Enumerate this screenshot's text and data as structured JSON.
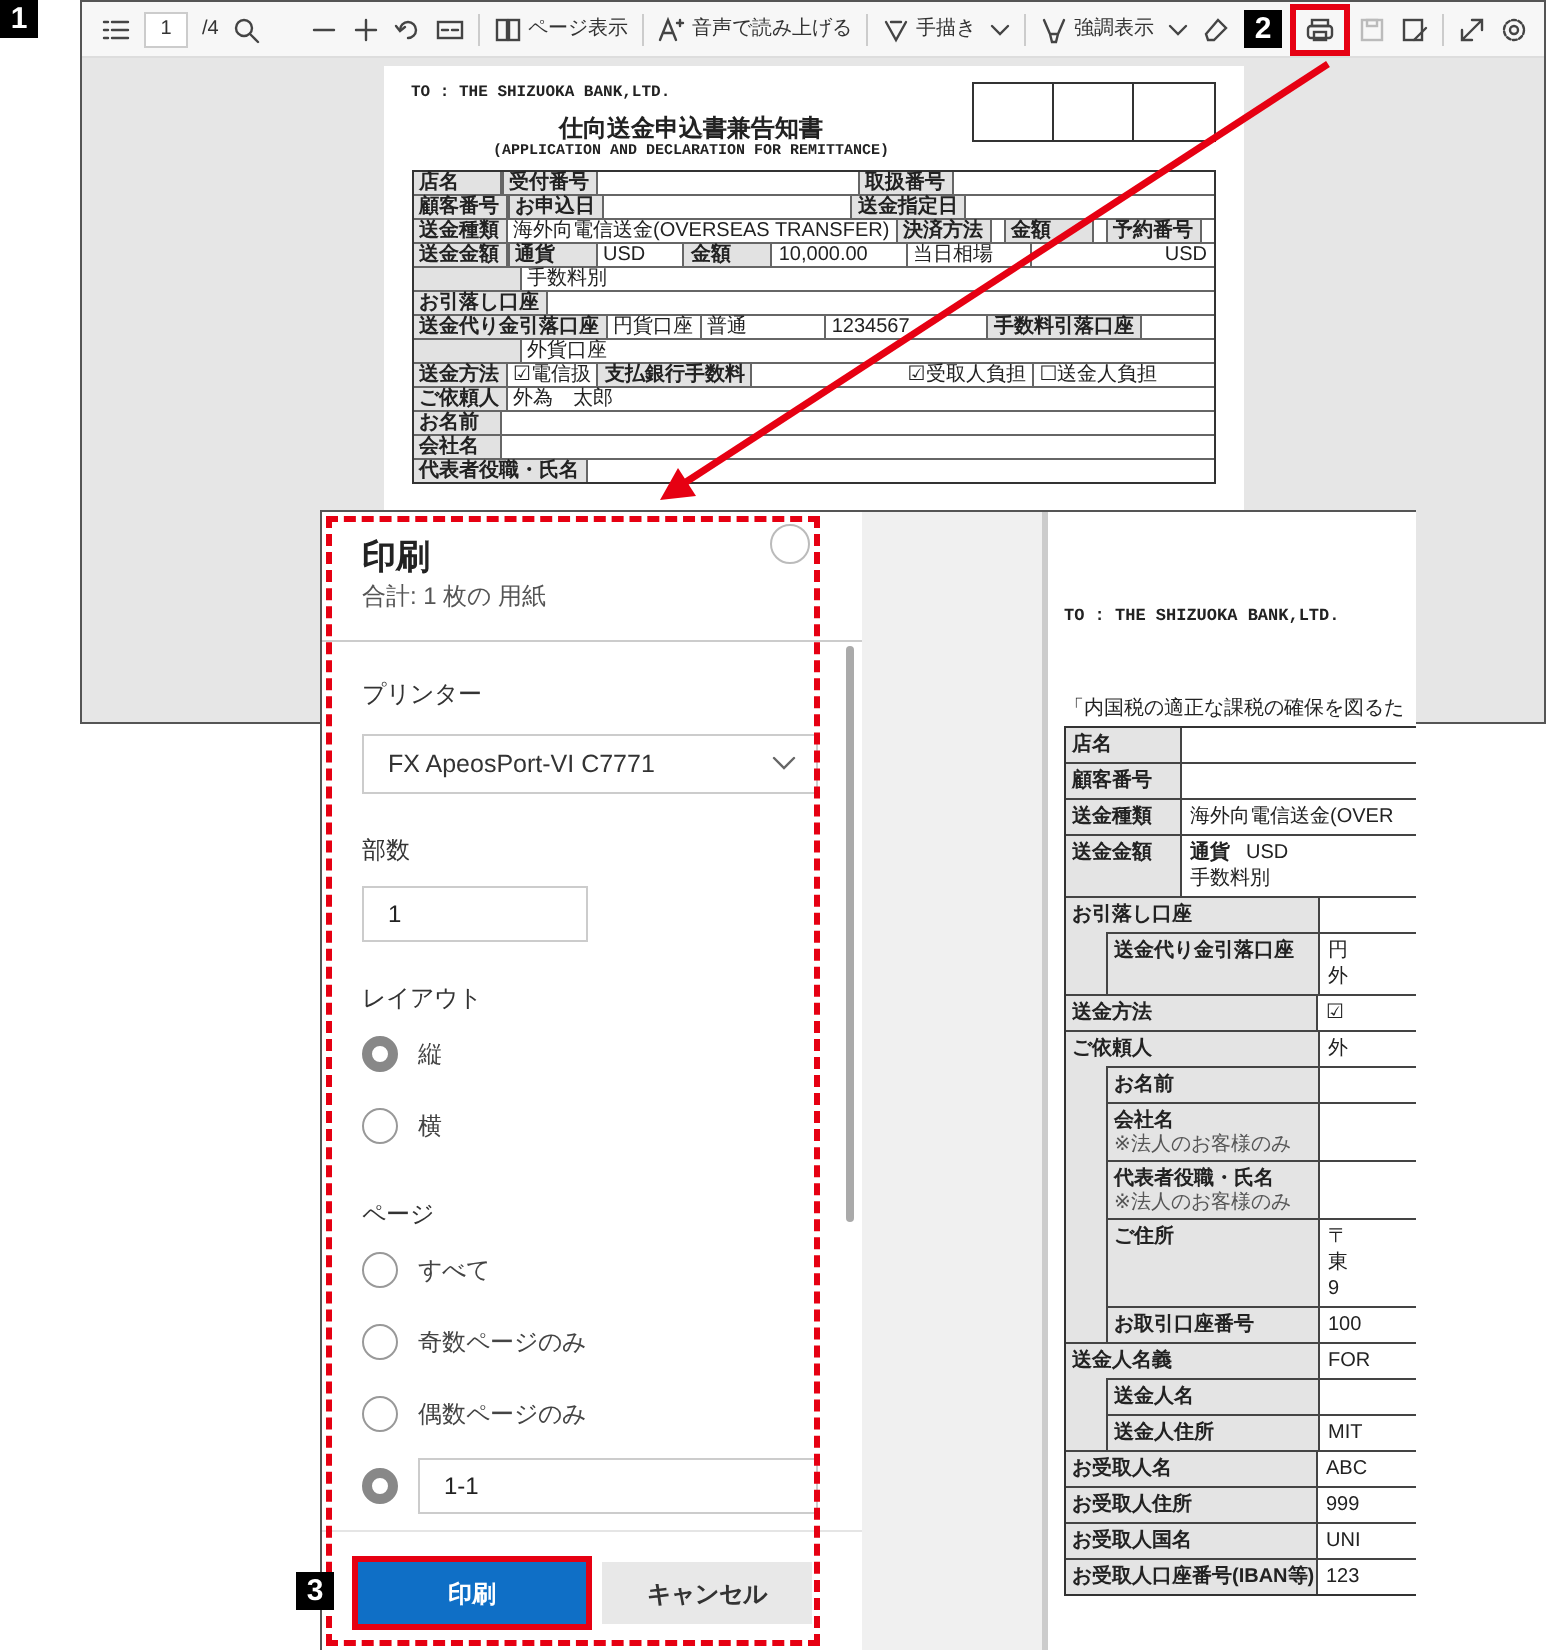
{
  "callouts": [
    "1",
    "2",
    "3"
  ],
  "viewer": {
    "toolbar": {
      "page_number": "1",
      "page_total": "/4",
      "actions": [
        {
          "kind": "page-view",
          "label": "ページ表示",
          "dropdown": false
        },
        {
          "kind": "read-aloud",
          "label": "音声で読み上げる",
          "dropdown": false
        },
        {
          "kind": "draw",
          "label": "手描き",
          "dropdown": true
        },
        {
          "kind": "highlight",
          "label": "強調表示",
          "dropdown": true
        }
      ]
    },
    "document": {
      "addressee": "TO : THE SHIZUOKA BANK,LTD.",
      "title": "仕向送金申込書兼告知書",
      "subtitle": "(APPLICATION AND DECLARATION FOR REMITTANCE)",
      "lines": [
        {
          "fields": [
            {
              "label": "店名"
            },
            {
              "label": "受付番号"
            },
            {
              "label": "取扱番号"
            }
          ]
        },
        {
          "fields": [
            {
              "label": "顧客番号"
            },
            {
              "label": "お申込日"
            },
            {
              "label": "送金指定日"
            }
          ]
        },
        {
          "fields": [
            {
              "label": "送金種類",
              "value": "海外向電信送金(OVERSEAS TRANSFER)"
            },
            {
              "label": "決済方法"
            },
            {
              "label": "金額"
            },
            {
              "label": "予約番号"
            }
          ]
        },
        {
          "fields": [
            {
              "label": "送金金額"
            },
            {
              "label": "通貨",
              "value": "USD"
            },
            {
              "label": "金額",
              "value": "10,000.00"
            },
            {
              "value": "当日相場"
            },
            {
              "value": "USD"
            }
          ]
        },
        {
          "fields": [
            {
              "value": "手数料別"
            }
          ]
        },
        {
          "fields": [
            {
              "label": "お引落し口座"
            }
          ]
        },
        {
          "fields": [
            {
              "label": "送金代り金引落口座",
              "value": "円貨口座"
            },
            {
              "value": "普通"
            },
            {
              "value": "1234567"
            },
            {
              "label": "手数料引落口座"
            }
          ]
        },
        {
          "fields": [
            {
              "value": "外貨口座"
            }
          ]
        },
        {
          "fields": [
            {
              "label": "送金方法",
              "value": "☑電信扱"
            },
            {
              "label": "支払銀行手数料",
              "value": "☑受取人負担"
            },
            {
              "value": "☐送金人負担"
            }
          ]
        },
        {
          "fields": [
            {
              "label": "ご依頼人",
              "value": "外為　太郎"
            }
          ]
        },
        {
          "fields": [
            {
              "label": "お名前"
            }
          ]
        },
        {
          "fields": [
            {
              "label": "会社名"
            }
          ]
        },
        {
          "fields": [
            {
              "label": "代表者役職・氏名"
            }
          ]
        }
      ]
    }
  },
  "print_dialog": {
    "title": "印刷",
    "summary": "合計: 1 枚の 用紙",
    "printer": {
      "label": "プリンター",
      "value": "FX ApeosPort-VI C7771"
    },
    "copies": {
      "label": "部数",
      "value": "1"
    },
    "layout": {
      "label": "レイアウト",
      "options": [
        {
          "label": "縦",
          "selected": true
        },
        {
          "label": "横",
          "selected": false
        }
      ]
    },
    "pages": {
      "label": "ページ",
      "options": [
        {
          "kind": "radio",
          "label": "すべて",
          "selected": false
        },
        {
          "kind": "radio",
          "label": "奇数ページのみ",
          "selected": false
        },
        {
          "kind": "radio",
          "label": "偶数ページのみ",
          "selected": false
        },
        {
          "kind": "range",
          "value": "1-1",
          "selected": true
        }
      ]
    },
    "buttons": [
      {
        "kind": "primary",
        "label": "印刷"
      },
      {
        "kind": "secondary",
        "label": "キャンセル"
      }
    ]
  },
  "preview": {
    "addressee": "TO : THE SHIZUOKA BANK,LTD.",
    "notice": "「内国税の適正な課税の確保を図るた",
    "rows": [
      {
        "kind": "header-field",
        "label": "店名"
      },
      {
        "kind": "header-field",
        "label": "顧客番号"
      },
      {
        "kind": "header-field",
        "label": "送金種類",
        "lines": [
          [
            {
              "kind": "value",
              "text": "海外向電信送金(OVER"
            }
          ]
        ]
      },
      {
        "kind": "header-field",
        "label": "送金金額",
        "lines": [
          [
            {
              "kind": "label",
              "text": "通貨"
            },
            {
              "kind": "value",
              "text": "USD"
            }
          ],
          [
            {
              "kind": "value",
              "text": "手数料別"
            }
          ]
        ]
      },
      {
        "label": "お引落し口座",
        "children": [
          {
            "label": "送金代り金引落口座",
            "lines": [
              [
                {
                  "kind": "value",
                  "text": "円"
                }
              ],
              [
                {
                  "kind": "value",
                  "text": "外"
                }
              ]
            ]
          }
        ]
      },
      {
        "label": "送金方法",
        "lines": [
          [
            {
              "kind": "value",
              "text": "☑"
            }
          ]
        ]
      },
      {
        "label": "ご依頼人",
        "lines": [
          [
            {
              "kind": "value",
              "text": "外"
            }
          ]
        ],
        "children": [
          {
            "label": "お名前"
          },
          {
            "label": "会社名",
            "note": "※法人のお客様のみ"
          },
          {
            "label": "代表者役職・氏名",
            "note": "※法人のお客様のみ"
          },
          {
            "label": "ご住所",
            "lines": [
              [
                {
                  "kind": "value",
                  "text": "〒"
                }
              ],
              [
                {
                  "kind": "value",
                  "text": "東"
                }
              ],
              [
                {
                  "kind": "value",
                  "text": "9"
                }
              ]
            ]
          },
          {
            "label": "お取引口座番号",
            "lines": [
              [
                {
                  "kind": "value",
                  "text": "100"
                }
              ]
            ]
          }
        ]
      },
      {
        "label": "送金人名義",
        "lines": [
          [
            {
              "kind": "value",
              "text": "FOR"
            }
          ]
        ],
        "children": [
          {
            "label": "送金人名"
          },
          {
            "label": "送金人住所",
            "lines": [
              [
                {
                  "kind": "value",
                  "text": "MIT"
                }
              ]
            ]
          }
        ]
      },
      {
        "label": "お受取人名",
        "lines": [
          [
            {
              "kind": "value",
              "text": "ABC"
            }
          ]
        ]
      },
      {
        "label": "お受取人住所",
        "lines": [
          [
            {
              "kind": "value",
              "text": "999"
            }
          ]
        ]
      },
      {
        "label": "お受取人国名",
        "lines": [
          [
            {
              "kind": "value",
              "text": "UNI"
            }
          ]
        ]
      },
      {
        "label": "お受取人口座番号(IBAN等)",
        "lines": [
          [
            {
              "kind": "value",
              "text": "123"
            }
          ]
        ]
      }
    ]
  }
}
